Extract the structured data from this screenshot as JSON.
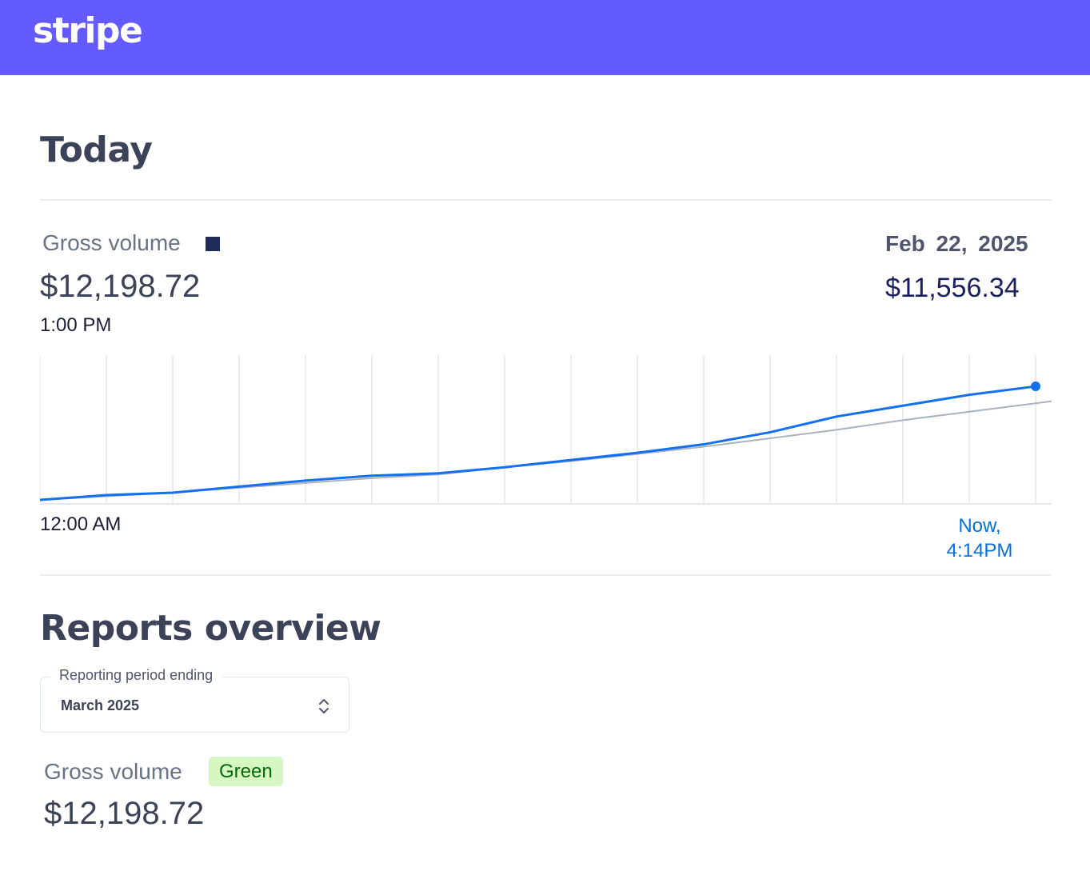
{
  "header": {
    "logo_text": "stripe",
    "brand_color": "#635bff"
  },
  "today": {
    "title": "Today",
    "gross_volume_label": "Gross volume",
    "gross_volume_amount": "$12,198.72",
    "time_label": "1:00 PM",
    "compare_date": "Feb 22, 2025",
    "compare_amount": "$11,556.34",
    "axis_start_label": "12:00 AM",
    "axis_end_label_line1": "Now,",
    "axis_end_label_line2": "4:14PM"
  },
  "chart_data": {
    "type": "line",
    "series": [
      {
        "color": "#1570ef",
        "values": [
          0,
          0.04,
          0.06,
          0.11,
          0.16,
          0.2,
          0.22,
          0.27,
          0.33,
          0.39,
          0.46,
          0.56,
          0.69,
          0.78,
          0.87,
          0.94
        ]
      },
      {
        "color": "#aab2bd",
        "values": [
          0,
          0.03,
          0.06,
          0.1,
          0.14,
          0.18,
          0.21,
          0.27,
          0.32,
          0.38,
          0.44,
          0.51,
          0.58,
          0.66,
          0.73,
          0.8
        ]
      }
    ],
    "grid": true,
    "ylim": [
      0,
      1
    ]
  },
  "reports": {
    "title": "Reports overview",
    "period_label": "Reporting period ending",
    "period_value": "March 2025",
    "gross_volume_label": "Gross volume",
    "badge_text": "Green",
    "gross_volume_amount": "$12,198.72"
  }
}
